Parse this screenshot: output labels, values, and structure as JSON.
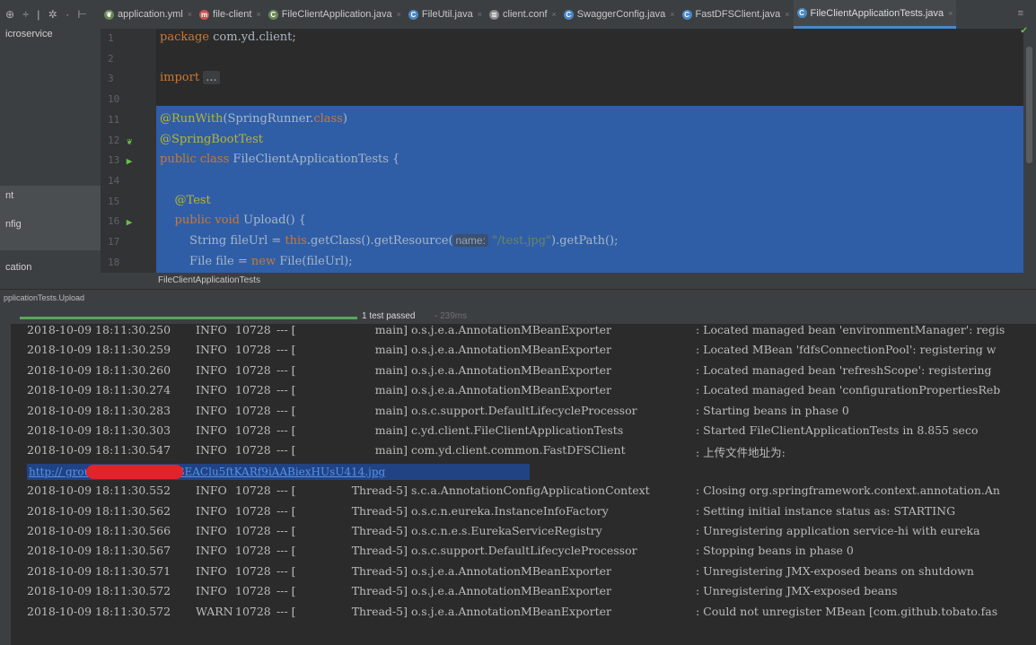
{
  "tabs": [
    {
      "label": "application.yml",
      "icon": "spring-leaf-icon",
      "color": "#6a8759"
    },
    {
      "label": "file-client",
      "icon": "maven-m-icon",
      "color": "#c75450"
    },
    {
      "label": "FileClientApplication.java",
      "icon": "spring-class-icon",
      "color": "#6a8759"
    },
    {
      "label": "FileUtil.java",
      "icon": "class-c-icon",
      "color": "#4a88c7"
    },
    {
      "label": "client.conf",
      "icon": "text-file-icon",
      "color": "#888888"
    },
    {
      "label": "SwaggerConfig.java",
      "icon": "class-c-icon",
      "color": "#4a88c7"
    },
    {
      "label": "FastDFSClient.java",
      "icon": "class-c-icon",
      "color": "#4a88c7"
    },
    {
      "label": "FileClientApplicationTests.java",
      "icon": "class-c-icon",
      "color": "#4a88c7",
      "active": true
    }
  ],
  "left_panel": {
    "items": [
      "icroservice",
      "nt",
      "nfig",
      "cation"
    ]
  },
  "editor": {
    "lines": [
      {
        "num": "1",
        "code": [
          {
            "t": "package ",
            "c": "kw"
          },
          {
            "t": "com.yd.client;",
            "c": ""
          }
        ]
      },
      {
        "num": "2",
        "code": []
      },
      {
        "num": "3",
        "code": [
          {
            "t": "import ",
            "c": "kw"
          },
          {
            "t": "...",
            "c": "fold"
          }
        ]
      },
      {
        "num": "10",
        "code": []
      },
      {
        "num": "11",
        "code": [
          {
            "t": "@RunWith",
            "c": "ann"
          },
          {
            "t": "(SpringRunner.",
            "c": ""
          },
          {
            "t": "class",
            "c": "kw"
          },
          {
            "t": ")",
            "c": ""
          }
        ]
      },
      {
        "num": "12",
        "code": [
          {
            "t": "@SpringBootTest",
            "c": "ann"
          }
        ]
      },
      {
        "num": "13",
        "code": [
          {
            "t": "public class ",
            "c": "kw"
          },
          {
            "t": "FileClientApplicationTests {",
            "c": ""
          }
        ]
      },
      {
        "num": "14",
        "code": []
      },
      {
        "num": "15",
        "code": [
          {
            "t": "    @Test",
            "c": "ann"
          }
        ]
      },
      {
        "num": "16",
        "code": [
          {
            "t": "    public void ",
            "c": "kw"
          },
          {
            "t": "Upload() {",
            "c": ""
          }
        ]
      },
      {
        "num": "17",
        "code": [
          {
            "t": "        String fileUrl = ",
            "c": ""
          },
          {
            "t": "this",
            "c": "kw"
          },
          {
            "t": ".getClass().getResource(",
            "c": ""
          },
          {
            "t": "name:",
            "c": "hint"
          },
          {
            "t": " \"/test.jpg\"",
            "c": "str"
          },
          {
            "t": ").getPath();",
            "c": ""
          }
        ]
      },
      {
        "num": "18",
        "code": [
          {
            "t": "        File file = ",
            "c": ""
          },
          {
            "t": "new ",
            "c": "kw"
          },
          {
            "t": "File(fileUrl);",
            "c": ""
          }
        ]
      }
    ],
    "gutter_icons": [
      {
        "line": "12",
        "icon": "spring-bean-icon",
        "color": "#6cbf4a"
      },
      {
        "line": "13",
        "icon": "run-test-icon",
        "color": "#6cbf4a"
      },
      {
        "line": "16",
        "icon": "run-test-icon",
        "color": "#6cbf4a"
      }
    ]
  },
  "breadcrumb": "FileClientApplicationTests",
  "run_config": "pplicationTests.Upload",
  "test_status": {
    "label": "1 test passed",
    "time": " - 239ms",
    "progress": 1.0,
    "color": "#58a65c"
  },
  "console": {
    "rows": [
      {
        "ts": "2018-10-09 18:11:30.250",
        "level": "INFO",
        "pid": "10728",
        "sep": "--- [",
        "thread": "main]",
        "logger": "o.s.j.e.a.AnnotationMBeanExporter",
        "msg": ": Located managed bean 'environmentManager': regis"
      },
      {
        "ts": "2018-10-09 18:11:30.259",
        "level": "INFO",
        "pid": "10728",
        "sep": "--- [",
        "thread": "main]",
        "logger": "o.s.j.e.a.AnnotationMBeanExporter",
        "msg": ": Located MBean 'fdfsConnectionPool': registering w"
      },
      {
        "ts": "2018-10-09 18:11:30.260",
        "level": "INFO",
        "pid": "10728",
        "sep": "--- [",
        "thread": "main]",
        "logger": "o.s.j.e.a.AnnotationMBeanExporter",
        "msg": ": Located managed bean 'refreshScope': registering"
      },
      {
        "ts": "2018-10-09 18:11:30.274",
        "level": "INFO",
        "pid": "10728",
        "sep": "--- [",
        "thread": "main]",
        "logger": "o.s.j.e.a.AnnotationMBeanExporter",
        "msg": ": Located managed bean 'configurationPropertiesReb"
      },
      {
        "ts": "2018-10-09 18:11:30.283",
        "level": "INFO",
        "pid": "10728",
        "sep": "--- [",
        "thread": "main]",
        "logger": "o.s.c.support.DefaultLifecycleProcessor",
        "msg": ": Starting beans in phase 0"
      },
      {
        "ts": "2018-10-09 18:11:30.303",
        "level": "INFO",
        "pid": "10728",
        "sep": "--- [",
        "thread": "main]",
        "logger": "c.yd.client.FileClientApplicationTests",
        "msg": ": Started FileClientApplicationTests in 8.855 seco"
      },
      {
        "ts": "2018-10-09 18:11:30.547",
        "level": "INFO",
        "pid": "10728",
        "sep": "--- [",
        "thread": "main]",
        "logger": "com.yd.client.common.FastDFSClient",
        "msg": ": 上传文件地址为:"
      },
      {
        "url": "http://                   group1/M00/00/00/rBEAClu5ftKARf9iAABiexHUsU414.jpg"
      },
      {
        "ts": "2018-10-09 18:11:30.552",
        "level": "INFO",
        "pid": "10728",
        "sep": "--- [",
        "thread": "Thread-5]",
        "logger": "s.c.a.AnnotationConfigApplicationContext",
        "msg": ": Closing org.springframework.context.annotation.An"
      },
      {
        "ts": "2018-10-09 18:11:30.562",
        "level": "INFO",
        "pid": "10728",
        "sep": "--- [",
        "thread": "Thread-5]",
        "logger": "o.s.c.n.eureka.InstanceInfoFactory",
        "msg": ": Setting initial instance status as: STARTING"
      },
      {
        "ts": "2018-10-09 18:11:30.566",
        "level": "INFO",
        "pid": "10728",
        "sep": "--- [",
        "thread": "Thread-5]",
        "logger": "o.s.c.n.e.s.EurekaServiceRegistry",
        "msg": ": Unregistering application service-hi with eureka"
      },
      {
        "ts": "2018-10-09 18:11:30.567",
        "level": "INFO",
        "pid": "10728",
        "sep": "--- [",
        "thread": "Thread-5]",
        "logger": "o.s.c.support.DefaultLifecycleProcessor",
        "msg": ": Stopping beans in phase 0"
      },
      {
        "ts": "2018-10-09 18:11:30.571",
        "level": "INFO",
        "pid": "10728",
        "sep": "--- [",
        "thread": "Thread-5]",
        "logger": "o.s.j.e.a.AnnotationMBeanExporter",
        "msg": ": Unregistering JMX-exposed beans on shutdown"
      },
      {
        "ts": "2018-10-09 18:11:30.572",
        "level": "INFO",
        "pid": "10728",
        "sep": "--- [",
        "thread": "Thread-5]",
        "logger": "o.s.j.e.a.AnnotationMBeanExporter",
        "msg": ": Unregistering JMX-exposed beans"
      },
      {
        "ts": "2018-10-09 18:11:30.572",
        "level": "WARN",
        "pid": "10728",
        "sep": "--- [",
        "thread": "Thread-5]",
        "logger": "o.s.j.e.a.AnnotationMBeanExporter",
        "msg": ": Could not unregister MBean [com.github.tobato.fas"
      }
    ]
  }
}
